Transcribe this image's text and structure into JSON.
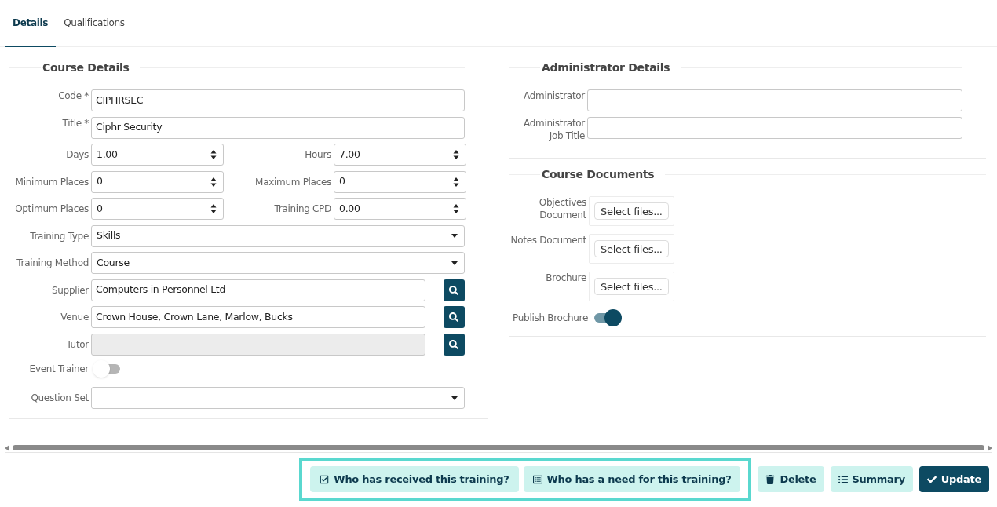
{
  "tabs": [
    {
      "label": "Details",
      "selected": true
    },
    {
      "label": "Qualifications",
      "selected": false
    }
  ],
  "course_details": {
    "title": "Course Details",
    "rows": [
      {
        "kind": "text",
        "label": "Code *",
        "value": "CIPHRSEC"
      },
      {
        "kind": "text",
        "label": "Title *",
        "value": "Ciphr Security"
      },
      {
        "kind": "pair",
        "items": [
          {
            "label": "Days",
            "value": "1.00"
          },
          {
            "label": "Hours",
            "value": "7.00"
          }
        ]
      },
      {
        "kind": "pair",
        "items": [
          {
            "label": "Minimum Places",
            "value": "0"
          },
          {
            "label": "Maximum Places",
            "value": "0"
          }
        ]
      },
      {
        "kind": "pair",
        "items": [
          {
            "label": "Optimum Places",
            "value": "0"
          },
          {
            "label": "Training CPD",
            "value": "0.00"
          }
        ]
      },
      {
        "kind": "select",
        "label": "Training Type",
        "value": "Skills"
      },
      {
        "kind": "select",
        "label": "Training Method",
        "value": "Course"
      },
      {
        "kind": "lookup",
        "label": "Supplier",
        "value": "Computers in Personnel Ltd",
        "disabled": false
      },
      {
        "kind": "lookup",
        "label": "Venue",
        "value": "Crown House, Crown Lane, Marlow, Bucks",
        "disabled": false
      },
      {
        "kind": "lookup",
        "label": "Tutor",
        "disabled": true
      },
      {
        "kind": "toggle",
        "label": "Event Trainer",
        "on": false
      },
      {
        "kind": "select",
        "label": "Question Set"
      }
    ]
  },
  "administrator_details": {
    "title": "Administrator Details",
    "rows": [
      {
        "kind": "text",
        "label": "Administrator"
      },
      {
        "kind": "text",
        "label": "Administrator Job Title"
      }
    ]
  },
  "course_documents": {
    "title": "Course Documents",
    "rows": [
      {
        "kind": "file",
        "label": "Objectives Document",
        "button": "Select files..."
      },
      {
        "kind": "file",
        "label": "Notes Document",
        "button": "Select files..."
      },
      {
        "kind": "file",
        "label": "Brochure",
        "button": "Select files..."
      },
      {
        "kind": "toggle",
        "label": "Publish Brochure",
        "on": true
      }
    ]
  },
  "actions": {
    "highlighted": [
      {
        "label": "Who has received this training?"
      },
      {
        "label": "Who has a need for this training?"
      }
    ],
    "buttons": [
      {
        "label": "Delete"
      },
      {
        "label": "Summary"
      },
      {
        "label": "Update"
      }
    ]
  }
}
